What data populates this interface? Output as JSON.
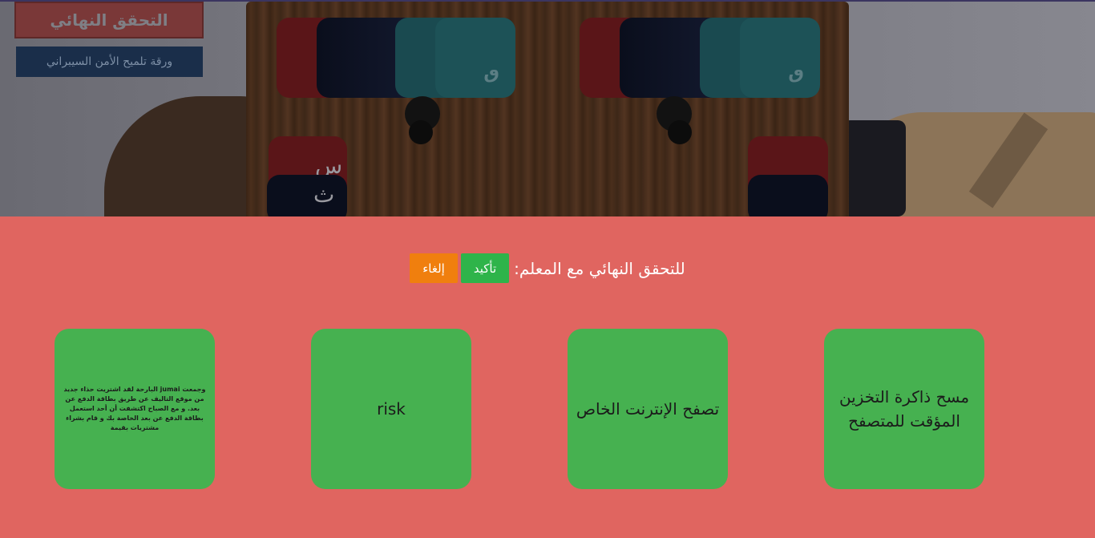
{
  "scene": {
    "final_check_button": "التحقق النهائي",
    "cheat_sheet_button": "ورقة تلميح الأمن السيبراني",
    "card_glyph": "ٯ",
    "side_glyph_top": "س",
    "side_glyph_bottom": "ث"
  },
  "panel": {
    "prompt": "للتحقق النهائي مع المعلم:",
    "confirm_label": "تأكيد",
    "cancel_label": "إلغاء"
  },
  "answer_cards": [
    {
      "text": "مسح ذاكرة التخزين المؤقت للمتصفح"
    },
    {
      "text": "تصفح الإنترنت الخاص"
    },
    {
      "text": "risk"
    },
    {
      "text": "وجمعت jumai البارحة لقد اشتريت حذاء جديد من موقع التاليف عن طريق بطاقة الدفع عن بعد. و مع الصباح اكتشفت أن أحد استعمل بطاقة الدفع عن بعد الخاصة بك و قام بشراء مشتريات بقيمة"
    }
  ],
  "colors": {
    "panel_bg": "#e06560",
    "card_bg": "#46b150",
    "confirm_bg": "#2eb44a",
    "cancel_bg": "#f07f0e"
  }
}
